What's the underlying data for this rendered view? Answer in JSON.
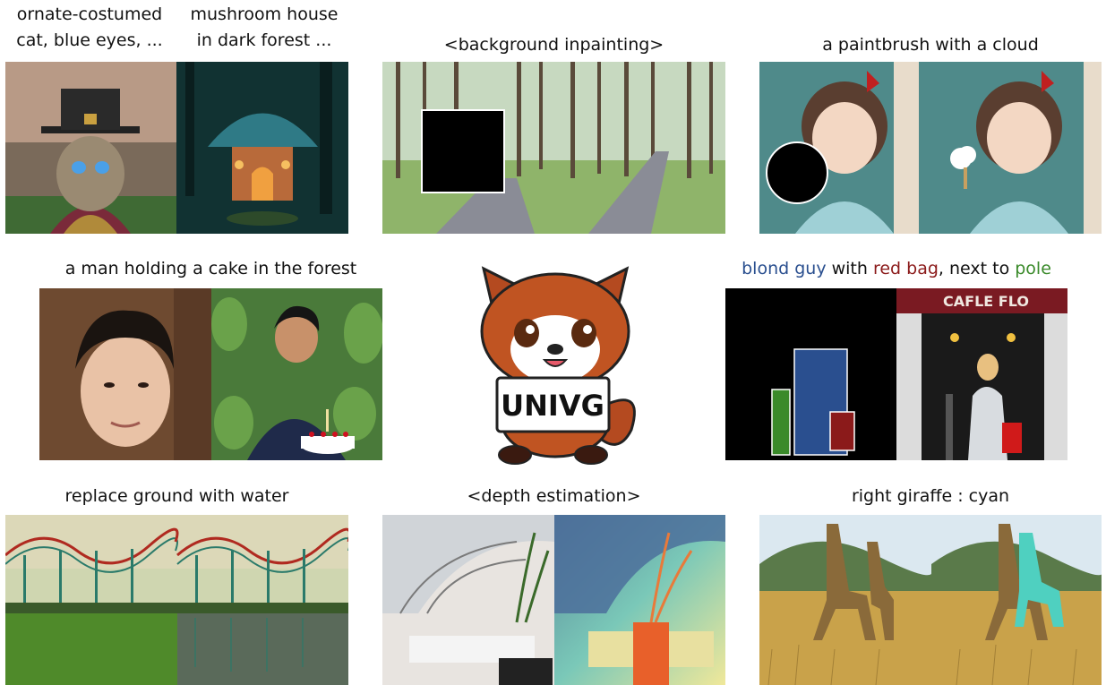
{
  "row1": {
    "cat_caption": [
      "ornate-costumed",
      "cat, blue eyes, ..."
    ],
    "mushroom_caption": [
      "mushroom house",
      "in dark forest ..."
    ],
    "inpaint_caption": "<background inpainting>",
    "paintbrush_caption": "a paintbrush with a cloud"
  },
  "row2": {
    "cake_caption": "a man holding a cake in the forest",
    "logo_text": "UNIVG",
    "layout_caption": {
      "part1": "blond guy",
      "part2": " with ",
      "part3": "red bag",
      "part4": ", next to ",
      "part5": "pole"
    },
    "storefront_sign": "CAFLE FLO"
  },
  "row3": {
    "water_caption": "replace ground with water",
    "depth_caption": "<depth estimation>",
    "giraffe_caption": "right giraffe : cyan"
  },
  "colors": {
    "blond_guy": "#2a4f8f",
    "red_bag": "#8b1a1a",
    "pole": "#3a8a2a"
  }
}
